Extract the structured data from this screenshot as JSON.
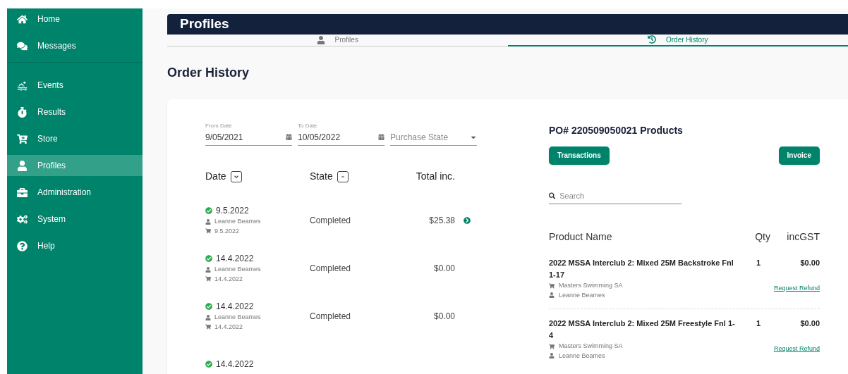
{
  "sidebar": {
    "sections": [
      {
        "items": [
          {
            "label": "Home",
            "selected": false
          },
          {
            "label": "Messages",
            "selected": false
          }
        ]
      },
      {
        "items": [
          {
            "label": "Events",
            "selected": false
          },
          {
            "label": "Results",
            "selected": false
          },
          {
            "label": "Store",
            "selected": false
          },
          {
            "label": "Profiles",
            "selected": true
          },
          {
            "label": "Administration",
            "selected": false
          },
          {
            "label": "System",
            "selected": false
          },
          {
            "label": "Help",
            "selected": false
          }
        ]
      }
    ]
  },
  "header": {
    "title": "Profiles"
  },
  "tabs": [
    {
      "label": "Profiles",
      "selected": false
    },
    {
      "label": "Order History",
      "selected": true
    }
  ],
  "heading": "Order History",
  "filters": [
    {
      "kind": "date",
      "label": "From Date",
      "value": "9/05/2021"
    },
    {
      "kind": "date",
      "label": "To Date",
      "value": "10/05/2022"
    },
    {
      "kind": "select",
      "placeholder": "Purchase State"
    }
  ],
  "orders": {
    "columns": [
      {
        "label": "Date"
      },
      {
        "label": "State"
      },
      {
        "label": "Total inc."
      }
    ],
    "rows": [
      {
        "date": "9.5.2022",
        "person": "Leanne Beames",
        "purchase_date": "9.5.2022",
        "state": "Completed",
        "total": "$25.38",
        "selected": true
      },
      {
        "date": "14.4.2022",
        "person": "Leanne Beames",
        "purchase_date": "14.4.2022",
        "state": "Completed",
        "total": "$0.00",
        "selected": false
      },
      {
        "date": "14.4.2022",
        "person": "Leanne Beames",
        "purchase_date": "14.4.2022",
        "state": "Completed",
        "total": "$0.00",
        "selected": false
      },
      {
        "date": "14.4.2022"
      }
    ]
  },
  "products_panel": {
    "title": "PO# 220509050021 Products",
    "buttons": [
      "Transactions",
      "Invoice"
    ],
    "search": {
      "placeholder": "Search"
    },
    "columns": [
      "Product Name",
      "Qty",
      "incGST"
    ],
    "rows": [
      {
        "name": "2022 MSSA Interclub 2: Mixed 25M Backstroke Fnl 1-17",
        "seller": "Masters Swimming SA",
        "person": "Leanne Beames",
        "qty": "1",
        "price": "$0.00",
        "link": "Request Refund"
      },
      {
        "name": "2022 MSSA Interclub 2: Mixed 25M Freestyle Fnl 1-4",
        "seller": "Masters Swimming SA",
        "person": "Leanne Beames",
        "qty": "1",
        "price": "$0.00",
        "link": "Request Refund"
      }
    ]
  }
}
